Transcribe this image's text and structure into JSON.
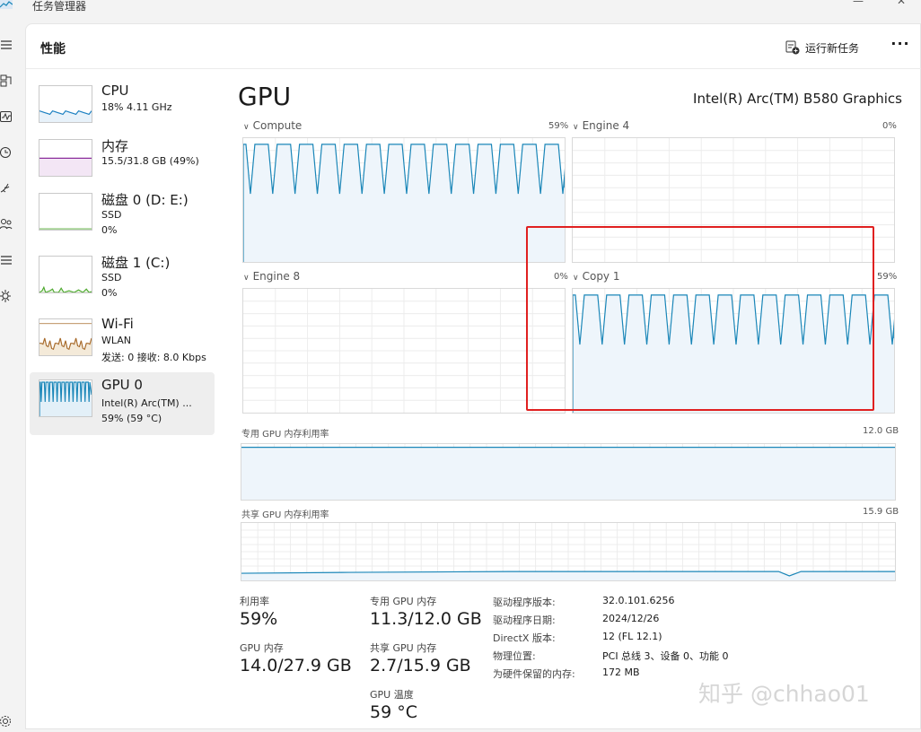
{
  "window": {
    "title": "任务管理器",
    "minimize_glyph": "—",
    "close_glyph": "✕"
  },
  "header": {
    "title": "性能",
    "run_task_label": "运行新任务",
    "run_task_icon": "run-new-task-icon",
    "more_glyph": "···"
  },
  "nav_icons": [
    "hamburger-menu-icon",
    "processes-icon",
    "performance-icon",
    "app-history-icon",
    "startup-apps-icon",
    "users-icon",
    "details-icon",
    "services-icon",
    "settings-icon"
  ],
  "sidebar": {
    "items": [
      {
        "name": "CPU",
        "sub1": "18% 4.11 GHz",
        "sub2": "",
        "sub3": "",
        "utilization_percent": 18,
        "color": "#1a7fc1"
      },
      {
        "name": "内存",
        "sub1": "15.5/31.8 GB (49%)",
        "sub2": "",
        "sub3": "",
        "utilization_percent": 49,
        "color": "#8b2d9b"
      },
      {
        "name": "磁盘 0 (D: E:)",
        "sub1": "SSD",
        "sub2": "0%",
        "sub3": "",
        "utilization_percent": 0,
        "color": "#4da82d"
      },
      {
        "name": "磁盘 1 (C:)",
        "sub1": "SSD",
        "sub2": "0%",
        "sub3": "",
        "utilization_percent": 0,
        "color": "#4da82d"
      },
      {
        "name": "Wi-Fi",
        "sub1": "WLAN",
        "sub2": "发送: 0 接收: 8.0 Kbps",
        "sub3": "",
        "color": "#a76a2a"
      },
      {
        "name": "GPU 0",
        "sub1": "Intel(R) Arc(TM) ...",
        "sub2": "59% (59 °C)",
        "sub3": "",
        "utilization_percent": 59,
        "color": "#1a86b8"
      }
    ]
  },
  "gpu": {
    "title": "GPU",
    "model": "Intel(R) Arc(TM) B580 Graphics",
    "engines": [
      {
        "label": "Compute",
        "percent_label": "59%",
        "utilization_percent": 59
      },
      {
        "label": "Engine 4",
        "percent_label": "0%",
        "utilization_percent": 0
      },
      {
        "label": "Engine 8",
        "percent_label": "0%",
        "utilization_percent": 0
      },
      {
        "label": "Copy 1",
        "percent_label": "59%",
        "utilization_percent": 59
      }
    ],
    "dedicated": {
      "label": "专用 GPU 内存利用率",
      "max_label": "12.0 GB"
    },
    "shared": {
      "label": "共享 GPU 内存利用率",
      "max_label": "15.9 GB"
    },
    "stats": {
      "utilization_label": "利用率",
      "utilization_value": "59%",
      "dedicated_mem_label": "专用 GPU 内存",
      "dedicated_mem_value": "11.3/12.0 GB",
      "gpu_mem_label": "GPU 内存",
      "gpu_mem_value": "14.0/27.9 GB",
      "shared_mem_label": "共享 GPU 内存",
      "shared_mem_value": "2.7/15.9 GB",
      "temp_label": "GPU 温度",
      "temp_value": "59 °C"
    },
    "info": [
      {
        "key": "驱动程序版本:",
        "value": "32.0.101.6256"
      },
      {
        "key": "驱动程序日期:",
        "value": "2024/12/26"
      },
      {
        "key": "DirectX 版本:",
        "value": "12 (FL 12.1)"
      },
      {
        "key": "物理位置:",
        "value": "PCI 总线 3、设备 0、功能 0"
      },
      {
        "key": "为硬件保留的内存:",
        "value": "172 MB"
      }
    ]
  },
  "watermark": "知乎 @chhao01",
  "colors": {
    "graph_line": "#1a86b8",
    "graph_fill": "#eef5fb",
    "highlight": "#e02020"
  }
}
